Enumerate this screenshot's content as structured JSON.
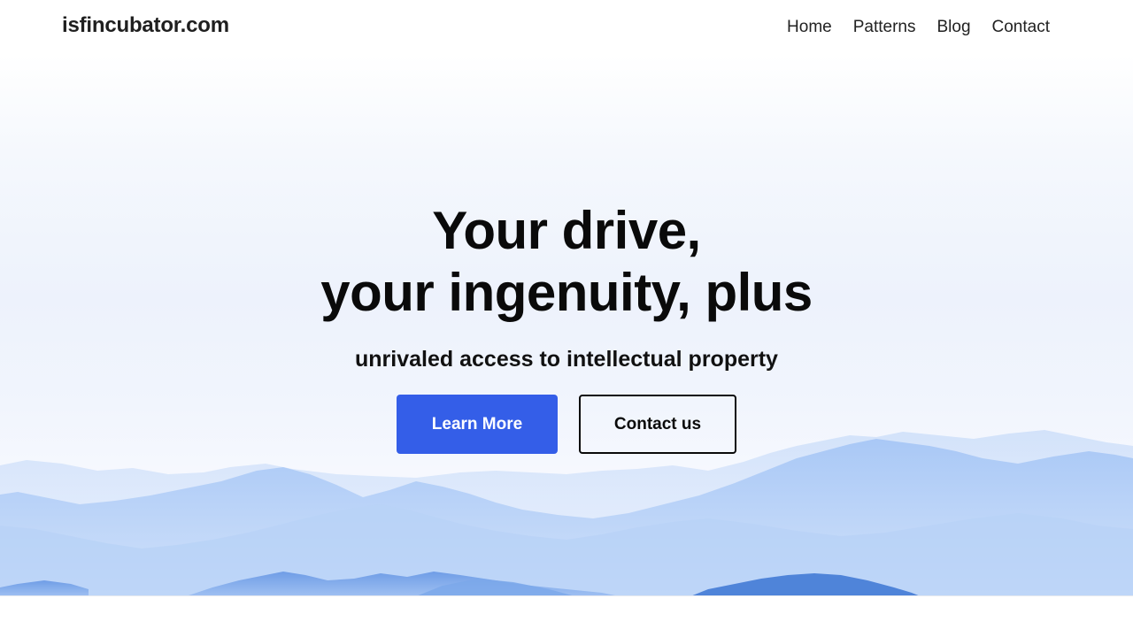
{
  "header": {
    "brand": "isfincubator.com",
    "nav": [
      "Home",
      "Patterns",
      "Blog",
      "Contact"
    ]
  },
  "hero": {
    "headline_line1": "Your drive,",
    "headline_line2": "your ingenuity, plus",
    "subhead": "unrivaled access to intellectual property",
    "primary_button": "Learn More",
    "secondary_button": "Contact us"
  },
  "colors": {
    "accent": "#345ee8",
    "text": "#0a0a0a",
    "mountain_light": "#c7dbf8",
    "mountain_mid": "#9ec0f3",
    "mountain_dark": "#5b8ee0"
  }
}
